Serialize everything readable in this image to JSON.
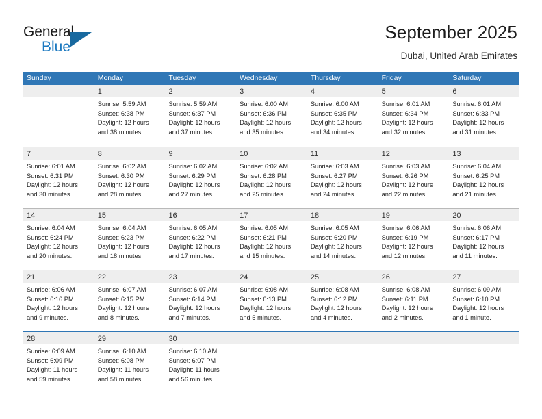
{
  "brand": {
    "name_part1": "General",
    "name_part2": "Blue",
    "accent_color": "#1c79c0",
    "triangle_color": "#18699f"
  },
  "header": {
    "title": "September 2025",
    "subtitle": "Dubai, United Arab Emirates"
  },
  "theme": {
    "header_row_bg": "#3077b6",
    "day_number_band_bg": "#eeeeee",
    "row_divider": "#b9b9b9",
    "last_row_divider": "#2f76b5",
    "text_color": "#232323"
  },
  "weekdays": [
    "Sunday",
    "Monday",
    "Tuesday",
    "Wednesday",
    "Thursday",
    "Friday",
    "Saturday"
  ],
  "calendar_data": {
    "type": "table",
    "month": "September",
    "year": 2025,
    "location": "Dubai, United Arab Emirates",
    "weeks": [
      [
        {
          "day": "",
          "lines": []
        },
        {
          "day": "1",
          "lines": [
            "Sunrise: 5:59 AM",
            "Sunset: 6:38 PM",
            "Daylight: 12 hours",
            "and 38 minutes."
          ]
        },
        {
          "day": "2",
          "lines": [
            "Sunrise: 5:59 AM",
            "Sunset: 6:37 PM",
            "Daylight: 12 hours",
            "and 37 minutes."
          ]
        },
        {
          "day": "3",
          "lines": [
            "Sunrise: 6:00 AM",
            "Sunset: 6:36 PM",
            "Daylight: 12 hours",
            "and 35 minutes."
          ]
        },
        {
          "day": "4",
          "lines": [
            "Sunrise: 6:00 AM",
            "Sunset: 6:35 PM",
            "Daylight: 12 hours",
            "and 34 minutes."
          ]
        },
        {
          "day": "5",
          "lines": [
            "Sunrise: 6:01 AM",
            "Sunset: 6:34 PM",
            "Daylight: 12 hours",
            "and 32 minutes."
          ]
        },
        {
          "day": "6",
          "lines": [
            "Sunrise: 6:01 AM",
            "Sunset: 6:33 PM",
            "Daylight: 12 hours",
            "and 31 minutes."
          ]
        }
      ],
      [
        {
          "day": "7",
          "lines": [
            "Sunrise: 6:01 AM",
            "Sunset: 6:31 PM",
            "Daylight: 12 hours",
            "and 30 minutes."
          ]
        },
        {
          "day": "8",
          "lines": [
            "Sunrise: 6:02 AM",
            "Sunset: 6:30 PM",
            "Daylight: 12 hours",
            "and 28 minutes."
          ]
        },
        {
          "day": "9",
          "lines": [
            "Sunrise: 6:02 AM",
            "Sunset: 6:29 PM",
            "Daylight: 12 hours",
            "and 27 minutes."
          ]
        },
        {
          "day": "10",
          "lines": [
            "Sunrise: 6:02 AM",
            "Sunset: 6:28 PM",
            "Daylight: 12 hours",
            "and 25 minutes."
          ]
        },
        {
          "day": "11",
          "lines": [
            "Sunrise: 6:03 AM",
            "Sunset: 6:27 PM",
            "Daylight: 12 hours",
            "and 24 minutes."
          ]
        },
        {
          "day": "12",
          "lines": [
            "Sunrise: 6:03 AM",
            "Sunset: 6:26 PM",
            "Daylight: 12 hours",
            "and 22 minutes."
          ]
        },
        {
          "day": "13",
          "lines": [
            "Sunrise: 6:04 AM",
            "Sunset: 6:25 PM",
            "Daylight: 12 hours",
            "and 21 minutes."
          ]
        }
      ],
      [
        {
          "day": "14",
          "lines": [
            "Sunrise: 6:04 AM",
            "Sunset: 6:24 PM",
            "Daylight: 12 hours",
            "and 20 minutes."
          ]
        },
        {
          "day": "15",
          "lines": [
            "Sunrise: 6:04 AM",
            "Sunset: 6:23 PM",
            "Daylight: 12 hours",
            "and 18 minutes."
          ]
        },
        {
          "day": "16",
          "lines": [
            "Sunrise: 6:05 AM",
            "Sunset: 6:22 PM",
            "Daylight: 12 hours",
            "and 17 minutes."
          ]
        },
        {
          "day": "17",
          "lines": [
            "Sunrise: 6:05 AM",
            "Sunset: 6:21 PM",
            "Daylight: 12 hours",
            "and 15 minutes."
          ]
        },
        {
          "day": "18",
          "lines": [
            "Sunrise: 6:05 AM",
            "Sunset: 6:20 PM",
            "Daylight: 12 hours",
            "and 14 minutes."
          ]
        },
        {
          "day": "19",
          "lines": [
            "Sunrise: 6:06 AM",
            "Sunset: 6:19 PM",
            "Daylight: 12 hours",
            "and 12 minutes."
          ]
        },
        {
          "day": "20",
          "lines": [
            "Sunrise: 6:06 AM",
            "Sunset: 6:17 PM",
            "Daylight: 12 hours",
            "and 11 minutes."
          ]
        }
      ],
      [
        {
          "day": "21",
          "lines": [
            "Sunrise: 6:06 AM",
            "Sunset: 6:16 PM",
            "Daylight: 12 hours",
            "and 9 minutes."
          ]
        },
        {
          "day": "22",
          "lines": [
            "Sunrise: 6:07 AM",
            "Sunset: 6:15 PM",
            "Daylight: 12 hours",
            "and 8 minutes."
          ]
        },
        {
          "day": "23",
          "lines": [
            "Sunrise: 6:07 AM",
            "Sunset: 6:14 PM",
            "Daylight: 12 hours",
            "and 7 minutes."
          ]
        },
        {
          "day": "24",
          "lines": [
            "Sunrise: 6:08 AM",
            "Sunset: 6:13 PM",
            "Daylight: 12 hours",
            "and 5 minutes."
          ]
        },
        {
          "day": "25",
          "lines": [
            "Sunrise: 6:08 AM",
            "Sunset: 6:12 PM",
            "Daylight: 12 hours",
            "and 4 minutes."
          ]
        },
        {
          "day": "26",
          "lines": [
            "Sunrise: 6:08 AM",
            "Sunset: 6:11 PM",
            "Daylight: 12 hours",
            "and 2 minutes."
          ]
        },
        {
          "day": "27",
          "lines": [
            "Sunrise: 6:09 AM",
            "Sunset: 6:10 PM",
            "Daylight: 12 hours",
            "and 1 minute."
          ]
        }
      ],
      [
        {
          "day": "28",
          "lines": [
            "Sunrise: 6:09 AM",
            "Sunset: 6:09 PM",
            "Daylight: 11 hours",
            "and 59 minutes."
          ]
        },
        {
          "day": "29",
          "lines": [
            "Sunrise: 6:10 AM",
            "Sunset: 6:08 PM",
            "Daylight: 11 hours",
            "and 58 minutes."
          ]
        },
        {
          "day": "30",
          "lines": [
            "Sunrise: 6:10 AM",
            "Sunset: 6:07 PM",
            "Daylight: 11 hours",
            "and 56 minutes."
          ]
        },
        {
          "day": "",
          "lines": []
        },
        {
          "day": "",
          "lines": []
        },
        {
          "day": "",
          "lines": []
        },
        {
          "day": "",
          "lines": []
        }
      ]
    ]
  }
}
